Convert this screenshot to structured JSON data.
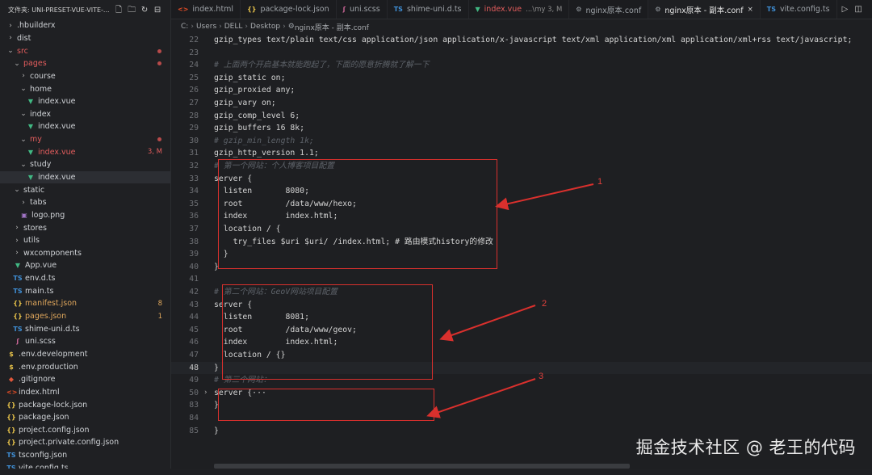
{
  "sidebar": {
    "header_label": "文件夹: UNI-PRESET-VUE-VITE-...",
    "header_icons": [
      "new-file-icon",
      "new-folder-icon",
      "refresh-icon",
      "collapse-icon"
    ],
    "items": [
      {
        "label": ".hbuilderx",
        "type": "folder",
        "level": 0,
        "expanded": false
      },
      {
        "label": "dist",
        "type": "folder",
        "level": 0,
        "expanded": false
      },
      {
        "label": "src",
        "type": "folder",
        "level": 0,
        "expanded": true,
        "status": "error",
        "dot": true
      },
      {
        "label": "pages",
        "type": "folder",
        "level": 1,
        "expanded": true,
        "status": "error",
        "dot": true
      },
      {
        "label": "course",
        "type": "folder",
        "level": 2,
        "expanded": false
      },
      {
        "label": "home",
        "type": "folder",
        "level": 2,
        "expanded": true
      },
      {
        "label": "index.vue",
        "type": "vue",
        "level": 3
      },
      {
        "label": "index",
        "type": "folder",
        "level": 2,
        "expanded": true
      },
      {
        "label": "index.vue",
        "type": "vue",
        "level": 3
      },
      {
        "label": "my",
        "type": "folder",
        "level": 2,
        "expanded": true,
        "status": "error",
        "dot": true
      },
      {
        "label": "index.vue",
        "type": "vue",
        "level": 3,
        "status": "error",
        "badge": "3, M"
      },
      {
        "label": "study",
        "type": "folder",
        "level": 2,
        "expanded": true
      },
      {
        "label": "index.vue",
        "type": "vue",
        "level": 3,
        "active": true
      },
      {
        "label": "static",
        "type": "folder",
        "level": 1,
        "expanded": true
      },
      {
        "label": "tabs",
        "type": "folder",
        "level": 2,
        "expanded": false
      },
      {
        "label": "logo.png",
        "type": "png",
        "level": 2
      },
      {
        "label": "stores",
        "type": "folder",
        "level": 1,
        "expanded": false
      },
      {
        "label": "utils",
        "type": "folder",
        "level": 1,
        "expanded": false
      },
      {
        "label": "wxcomponents",
        "type": "folder",
        "level": 1,
        "expanded": false
      },
      {
        "label": "App.vue",
        "type": "vue",
        "level": 1
      },
      {
        "label": "env.d.ts",
        "type": "ts",
        "level": 1
      },
      {
        "label": "main.ts",
        "type": "ts",
        "level": 1
      },
      {
        "label": "manifest.json",
        "type": "json",
        "level": 1,
        "status": "warn",
        "badge": "8"
      },
      {
        "label": "pages.json",
        "type": "json",
        "level": 1,
        "status": "warn",
        "badge": "1"
      },
      {
        "label": "shime-uni.d.ts",
        "type": "ts",
        "level": 1
      },
      {
        "label": "uni.scss",
        "type": "scss",
        "level": 1
      },
      {
        "label": ".env.development",
        "type": "env",
        "level": 0
      },
      {
        "label": ".env.production",
        "type": "env",
        "level": 0
      },
      {
        "label": ".gitignore",
        "type": "git",
        "level": 0
      },
      {
        "label": "index.html",
        "type": "html",
        "level": 0
      },
      {
        "label": "package-lock.json",
        "type": "json",
        "level": 0
      },
      {
        "label": "package.json",
        "type": "json",
        "level": 0
      },
      {
        "label": "project.config.json",
        "type": "json",
        "level": 0
      },
      {
        "label": "project.private.config.json",
        "type": "json",
        "level": 0
      },
      {
        "label": "tsconfig.json",
        "type": "ts",
        "level": 0
      },
      {
        "label": "vite.config.ts",
        "type": "ts",
        "level": 0
      }
    ]
  },
  "tabs": [
    {
      "label": "index.html",
      "icon": "html"
    },
    {
      "label": "package-lock.json",
      "icon": "json"
    },
    {
      "label": "uni.scss",
      "icon": "scss"
    },
    {
      "label": "shime-uni.d.ts",
      "icon": "ts"
    },
    {
      "label": "index.vue",
      "icon": "vue",
      "extra": "...\\my 3, M",
      "status": "error"
    },
    {
      "label": "nginx原本.conf",
      "icon": "gear"
    },
    {
      "label": "nginx原本 - 副本.conf",
      "icon": "gear",
      "active": true,
      "close": "×"
    },
    {
      "label": "vite.config.ts",
      "icon": "ts"
    }
  ],
  "tab_actions": [
    "run-icon",
    "split-editor-icon"
  ],
  "breadcrumb": [
    "C:",
    "Users",
    "DELL",
    "Desktop",
    "nginx原本 - 副本.conf"
  ],
  "code_lines": [
    {
      "n": "22",
      "text": "gzip_types text/plain text/css application/json application/x-javascript text/xml application/xml application/xml+rss text/javascript;"
    },
    {
      "n": "23",
      "text": ""
    },
    {
      "n": "24",
      "text": "# 上面两个开启基本就能跑起了，下面的愿意折腾就了解一下",
      "comment": true
    },
    {
      "n": "25",
      "text": "gzip_static on;"
    },
    {
      "n": "26",
      "text": "gzip_proxied any;"
    },
    {
      "n": "27",
      "text": "gzip_vary on;"
    },
    {
      "n": "28",
      "text": "gzip_comp_level 6;"
    },
    {
      "n": "29",
      "text": "gzip_buffers 16 8k;"
    },
    {
      "n": "30",
      "text": "# gzip_min_length 1k;",
      "comment": true
    },
    {
      "n": "31",
      "text": "gzip_http_version 1.1;"
    },
    {
      "n": "32",
      "text": "# 第一个网站：个人博客项目配置",
      "comment": true
    },
    {
      "n": "33",
      "text": "server {"
    },
    {
      "n": "34",
      "text": "  listen       8080;"
    },
    {
      "n": "35",
      "text": "  root         /data/www/hexo;"
    },
    {
      "n": "36",
      "text": "  index        index.html;"
    },
    {
      "n": "37",
      "text": "  location / {"
    },
    {
      "n": "38",
      "text": "    try_files $uri $uri/ /index.html; # 路由模式history的修改"
    },
    {
      "n": "39",
      "text": "  }"
    },
    {
      "n": "40",
      "text": "}"
    },
    {
      "n": "41",
      "text": ""
    },
    {
      "n": "42",
      "text": "# 第二个网站：GeoV网站项目配置",
      "comment": true
    },
    {
      "n": "43",
      "text": "server {"
    },
    {
      "n": "44",
      "text": "  listen       8081;"
    },
    {
      "n": "45",
      "text": "  root         /data/www/geov;"
    },
    {
      "n": "46",
      "text": "  index        index.html;"
    },
    {
      "n": "47",
      "text": "  location / {}"
    },
    {
      "n": "48",
      "text": "}",
      "current": true
    },
    {
      "n": "49",
      "text": "# 第三个网站：",
      "comment": true
    },
    {
      "n": "50",
      "text": "server {···",
      "fold": "›"
    },
    {
      "n": "83",
      "text": "}"
    },
    {
      "n": "84",
      "text": ""
    },
    {
      "n": "85",
      "text": "}"
    }
  ],
  "annotations": [
    "1",
    "2",
    "3"
  ],
  "watermark": "掘金技术社区 @ 老王的代码",
  "colors": {
    "annotation_red": "#d9302d",
    "comment": "#5d6269",
    "vue_green": "#41b883",
    "ts_blue": "#3f8fd6",
    "json_yellow": "#e8c34a"
  }
}
